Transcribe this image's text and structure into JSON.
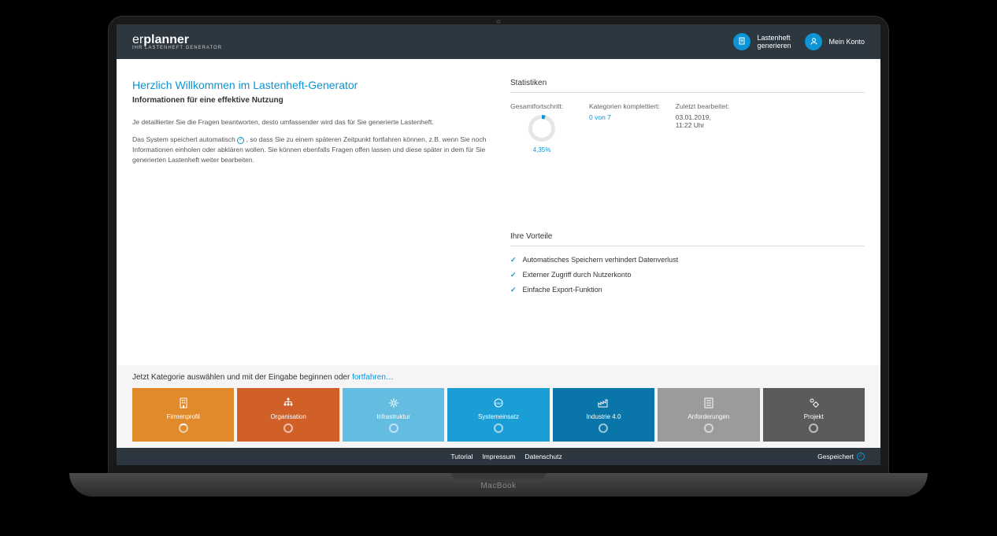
{
  "logo": {
    "prefix": "er",
    "suffix": "planner",
    "tagline": "IHR LASTENHEFT GENERATOR"
  },
  "header": {
    "generate": {
      "line1": "Lastenheft",
      "line2": "generieren"
    },
    "account": "Mein Konto"
  },
  "welcome": {
    "title": "Herzlich Willkommen im Lastenheft-Generator",
    "subtitle": "Informationen für eine effektive Nutzung",
    "p1": "Je detaillierter Sie die Fragen beantworten, desto umfassender wird das für Sie generierte Lastenheft.",
    "p2a": "Das System speichert automatisch ",
    "p2b": " , so dass Sie zu einem späteren Zeitpunkt fortfahren können, z.B. wenn Sie noch Informationen einholen oder abklären wollen. Sie können ebenfalls Fragen offen lassen und diese später in dem für Sie generierten Lastenheft weiter bearbeiten."
  },
  "stats": {
    "title": "Statistiken",
    "progress_label": "Gesamtfortschritt:",
    "progress_value": "4,35%",
    "completed_label": "Kategorien komplettiert:",
    "completed_value": "0 von 7",
    "edited_label": "Zuletzt bearbeitet:",
    "edited_date": "03.01.2019,",
    "edited_time": "11:22 Uhr"
  },
  "benefits": {
    "title": "Ihre Vorteile",
    "items": [
      "Automatisches Speichern verhindert Datenverlust",
      "Externer Zugriff durch Nutzerkonto",
      "Einfache Export-Funktion"
    ]
  },
  "categories": {
    "prompt_text": "Jetzt Kategorie auswählen und mit der Eingabe beginnen oder ",
    "prompt_link": "fortfahren…",
    "items": [
      {
        "label": "Firmenprofil",
        "color": "#e08a2c"
      },
      {
        "label": "Organisation",
        "color": "#d05f28"
      },
      {
        "label": "Infrastruktur",
        "color": "#64bce0"
      },
      {
        "label": "Systemeinsatz",
        "color": "#1b9ed6"
      },
      {
        "label": "Industrie 4.0",
        "color": "#0975a8"
      },
      {
        "label": "Anforderungen",
        "color": "#9b9b9b"
      },
      {
        "label": "Projekt",
        "color": "#5b5b5b"
      }
    ]
  },
  "footer": {
    "links": [
      "Tutorial",
      "Impressum",
      "Datenschutz"
    ],
    "saved": "Gespeichert"
  },
  "device": "MacBook"
}
